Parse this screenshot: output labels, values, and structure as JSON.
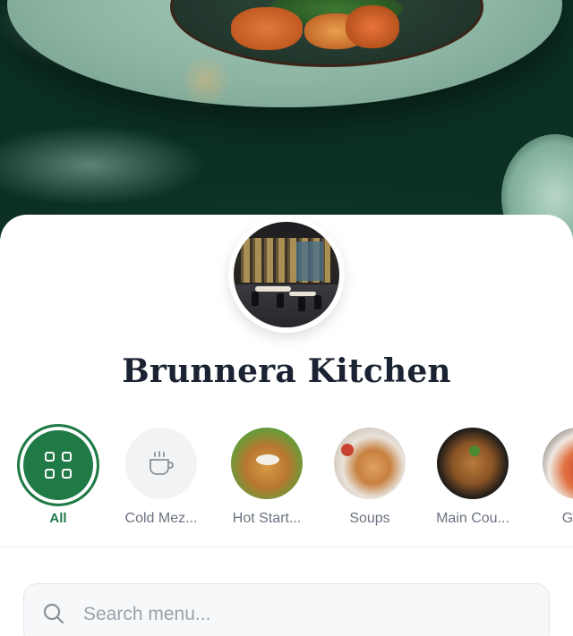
{
  "restaurant": {
    "name": "Brunnera Kitchen"
  },
  "categories": [
    {
      "label": "All",
      "icon": "grid-icon",
      "active": true
    },
    {
      "label": "Cold Mez...",
      "icon": "coffee-cup-icon",
      "active": false
    },
    {
      "label": "Hot Start...",
      "icon": "hot-starters-photo",
      "active": false
    },
    {
      "label": "Soups",
      "icon": "soups-photo",
      "active": false
    },
    {
      "label": "Main Cou...",
      "icon": "main-course-photo",
      "active": false
    },
    {
      "label": "Grills",
      "icon": "grills-photo",
      "active": false
    }
  ],
  "search": {
    "placeholder": "Search menu..."
  },
  "colors": {
    "accent": "#1f7a46",
    "title": "#1b2333",
    "muted": "#6b7280"
  }
}
